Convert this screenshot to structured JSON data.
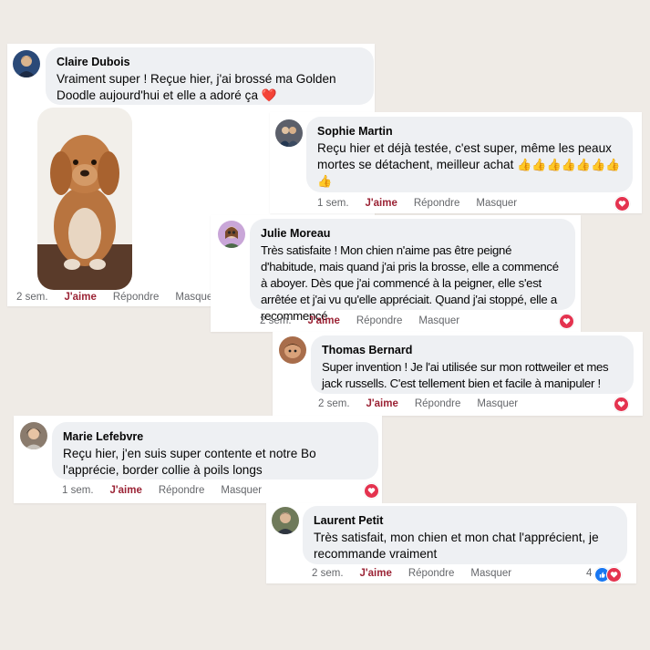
{
  "comments": [
    {
      "name": "Claire Dubois",
      "text": "Vraiment super ! Reçue hier, j'ai brossé ma Golden Doodle aujourd'hui et elle a adoré ça",
      "emoji": "❤️",
      "time": "2 sem.",
      "like": "J'aime",
      "reply": "Répondre",
      "hide": "Masquer",
      "avatar_color": "#2b4a78"
    },
    {
      "name": "Sophie Martin",
      "text": "Reçu hier et déjà testée, c'est super, même les peaux mortes se détachent, meilleur achat",
      "emoji": "👍👍👍👍👍👍👍👍",
      "time": "1 sem.",
      "like": "J'aime",
      "reply": "Répondre",
      "hide": "Masquer",
      "avatar_color": "#5b5f6a"
    },
    {
      "name": "Julie Moreau",
      "text": "Très satisfaite ! Mon chien n'aime pas être peigné d'habitude, mais quand j'ai pris la brosse, elle a commencé à aboyer. Dès que j'ai commencé à la peigner, elle s'est arrêtée et j'ai vu qu'elle appréciait. Quand j'ai stoppé, elle a recommencé",
      "time": "2 sem.",
      "like": "J'aime",
      "reply": "Répondre",
      "hide": "Masquer",
      "avatar_color": "#c9a6d8"
    },
    {
      "name": "Thomas Bernard",
      "text": "Super invention ! Je l'ai utilisée sur mon rottweiler et mes jack russells. C'est tellement bien et facile à manipuler !",
      "time": "2 sem.",
      "like": "J'aime",
      "reply": "Répondre",
      "hide": "Masquer",
      "avatar_color": "#a86d4b"
    },
    {
      "name": "Marie Lefebvre",
      "text": "Reçu hier, j'en suis super contente et notre Bo l'apprécie, border collie à poils longs",
      "time": "1 sem.",
      "like": "J'aime",
      "reply": "Répondre",
      "hide": "Masquer",
      "avatar_color": "#8a7b6d"
    },
    {
      "name": "Laurent Petit",
      "text": "Très satisfait, mon chien et mon chat l'apprécient, je recommande vraiment",
      "time": "2 sem.",
      "like": "J'aime",
      "reply": "Répondre",
      "hide": "Masquer",
      "reaction_count": "4",
      "avatar_color": "#6f7a5a"
    }
  ],
  "colors": {
    "background": "#efebe6",
    "bubble": "#eef0f3",
    "like_text": "#9b2335",
    "heart": "#e4334f",
    "like_blue": "#1877f2"
  },
  "icons": [
    "heart-reaction-icon",
    "like-reaction-icon",
    "user-avatar"
  ]
}
